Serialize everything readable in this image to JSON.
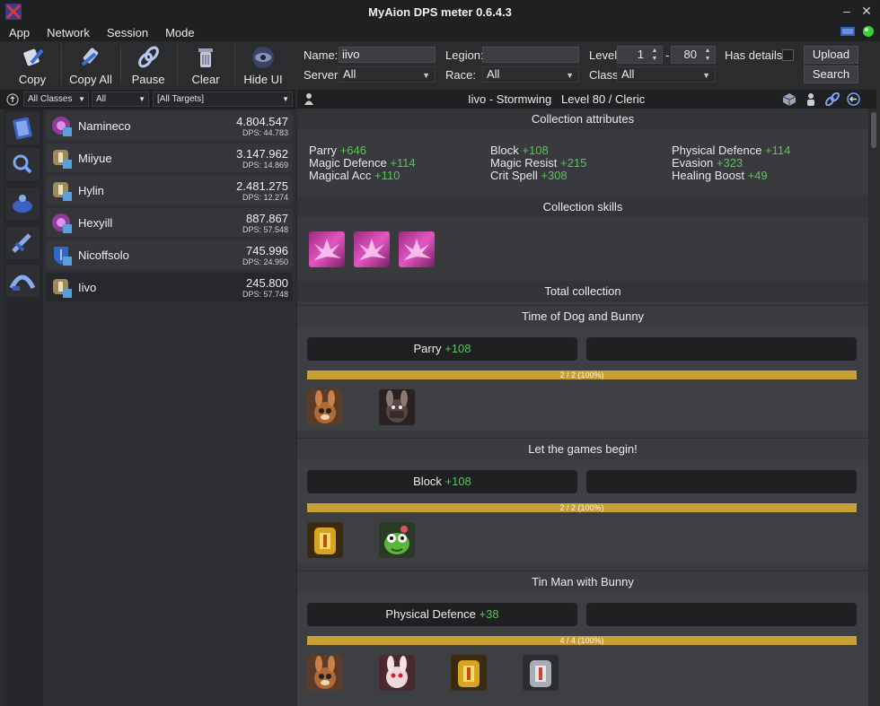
{
  "window": {
    "title": "MyAion DPS meter 0.6.4.3"
  },
  "menu": [
    "App",
    "Network",
    "Session",
    "Mode"
  ],
  "toolbar": {
    "copy": "Copy",
    "copy_all": "Copy All",
    "pause": "Pause",
    "clear": "Clear",
    "hide_ui": "Hide UI"
  },
  "form": {
    "name_label": "Name:",
    "name_value": "iivo",
    "legion_label": "Legion:",
    "legion_value": "",
    "level_label": "Level:",
    "level_min": "1",
    "level_dash": "-",
    "level_max": "80",
    "has_details_label": "Has details:",
    "upload": "Upload",
    "search": "Search",
    "server_label": "Server:",
    "server_value": "All",
    "race_label": "Race:",
    "race_value": "All",
    "class_label": "Class:",
    "class_value": "All"
  },
  "filters": {
    "classes": "All Classes",
    "all": "All",
    "targets": "[All Targets]"
  },
  "players": [
    {
      "name": "Namineco",
      "value": "4.804.547",
      "dps": "DPS: 44.783"
    },
    {
      "name": "Miiyue",
      "value": "3.147.962",
      "dps": "DPS: 14.869"
    },
    {
      "name": "Hylin",
      "value": "2.481.275",
      "dps": "DPS: 12.274"
    },
    {
      "name": "Hexyill",
      "value": "887.867",
      "dps": "DPS: 57.548"
    },
    {
      "name": "Nicoffsolo",
      "value": "745.996",
      "dps": "DPS: 24.950"
    },
    {
      "name": "Iivo",
      "value": "245.800",
      "dps": "DPS: 57.748"
    }
  ],
  "detail": {
    "header": "Iivo - Stormwing   Level 80 / Cleric",
    "collection_attributes": "Collection attributes",
    "attributes": [
      {
        "name": "Parry",
        "bonus": "+646"
      },
      {
        "name": "Block",
        "bonus": "+108"
      },
      {
        "name": "Physical Defence",
        "bonus": "+114"
      },
      {
        "name": "Magic Defence",
        "bonus": "+114"
      },
      {
        "name": "Magic Resist",
        "bonus": "+215"
      },
      {
        "name": "Evasion",
        "bonus": "+323"
      },
      {
        "name": "Magical Acc",
        "bonus": "+110"
      },
      {
        "name": "Crit Spell",
        "bonus": "+308"
      },
      {
        "name": "Healing Boost",
        "bonus": "+49"
      }
    ],
    "collection_skills": "Collection skills",
    "total_collection": "Total collection",
    "groups": [
      {
        "title": "Time of Dog and Bunny",
        "stat": "Parry",
        "bonus": "+108",
        "progress": "2 / 2 (100%)",
        "percent": 100
      },
      {
        "title": "Let the games begin!",
        "stat": "Block",
        "bonus": "+108",
        "progress": "2 / 2 (100%)",
        "percent": 100
      },
      {
        "title": "Tin Man with Bunny",
        "stat": "Physical Defence",
        "bonus": "+38",
        "progress": "4 / 4 (100%)",
        "percent": 100
      }
    ]
  },
  "colors": {
    "accent_green": "#56c45b",
    "progress_gold": "#c99f35",
    "bg": "#2b2c2e"
  }
}
